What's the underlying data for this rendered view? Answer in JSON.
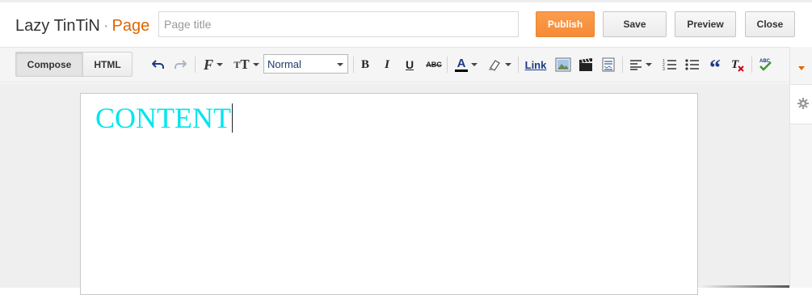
{
  "header": {
    "blog_name": "Lazy TinTiN",
    "separator": "·",
    "section": "Page",
    "title_placeholder": "Page title",
    "title_value": "",
    "publish_label": "Publish",
    "save_label": "Save",
    "preview_label": "Preview",
    "close_label": "Close",
    "accent_color": "#f68a35"
  },
  "toolbar": {
    "compose_label": "Compose",
    "html_label": "HTML",
    "active_mode": "Compose",
    "format_value": "Normal",
    "link_label": "Link",
    "icons": [
      "undo-icon",
      "redo-icon",
      "font-family-icon",
      "font-size-icon",
      "bold-icon",
      "italic-icon",
      "underline-icon",
      "strikethrough-icon",
      "text-color-icon",
      "highlight-icon",
      "link-icon",
      "insert-image-icon",
      "insert-video-icon",
      "insert-jump-break-icon",
      "alignment-icon",
      "numbered-list-icon",
      "bulleted-list-icon",
      "quote-icon",
      "remove-formatting-icon",
      "spellcheck-icon"
    ]
  },
  "editor": {
    "content": "CONTENT",
    "content_color": "#00e5ee"
  }
}
